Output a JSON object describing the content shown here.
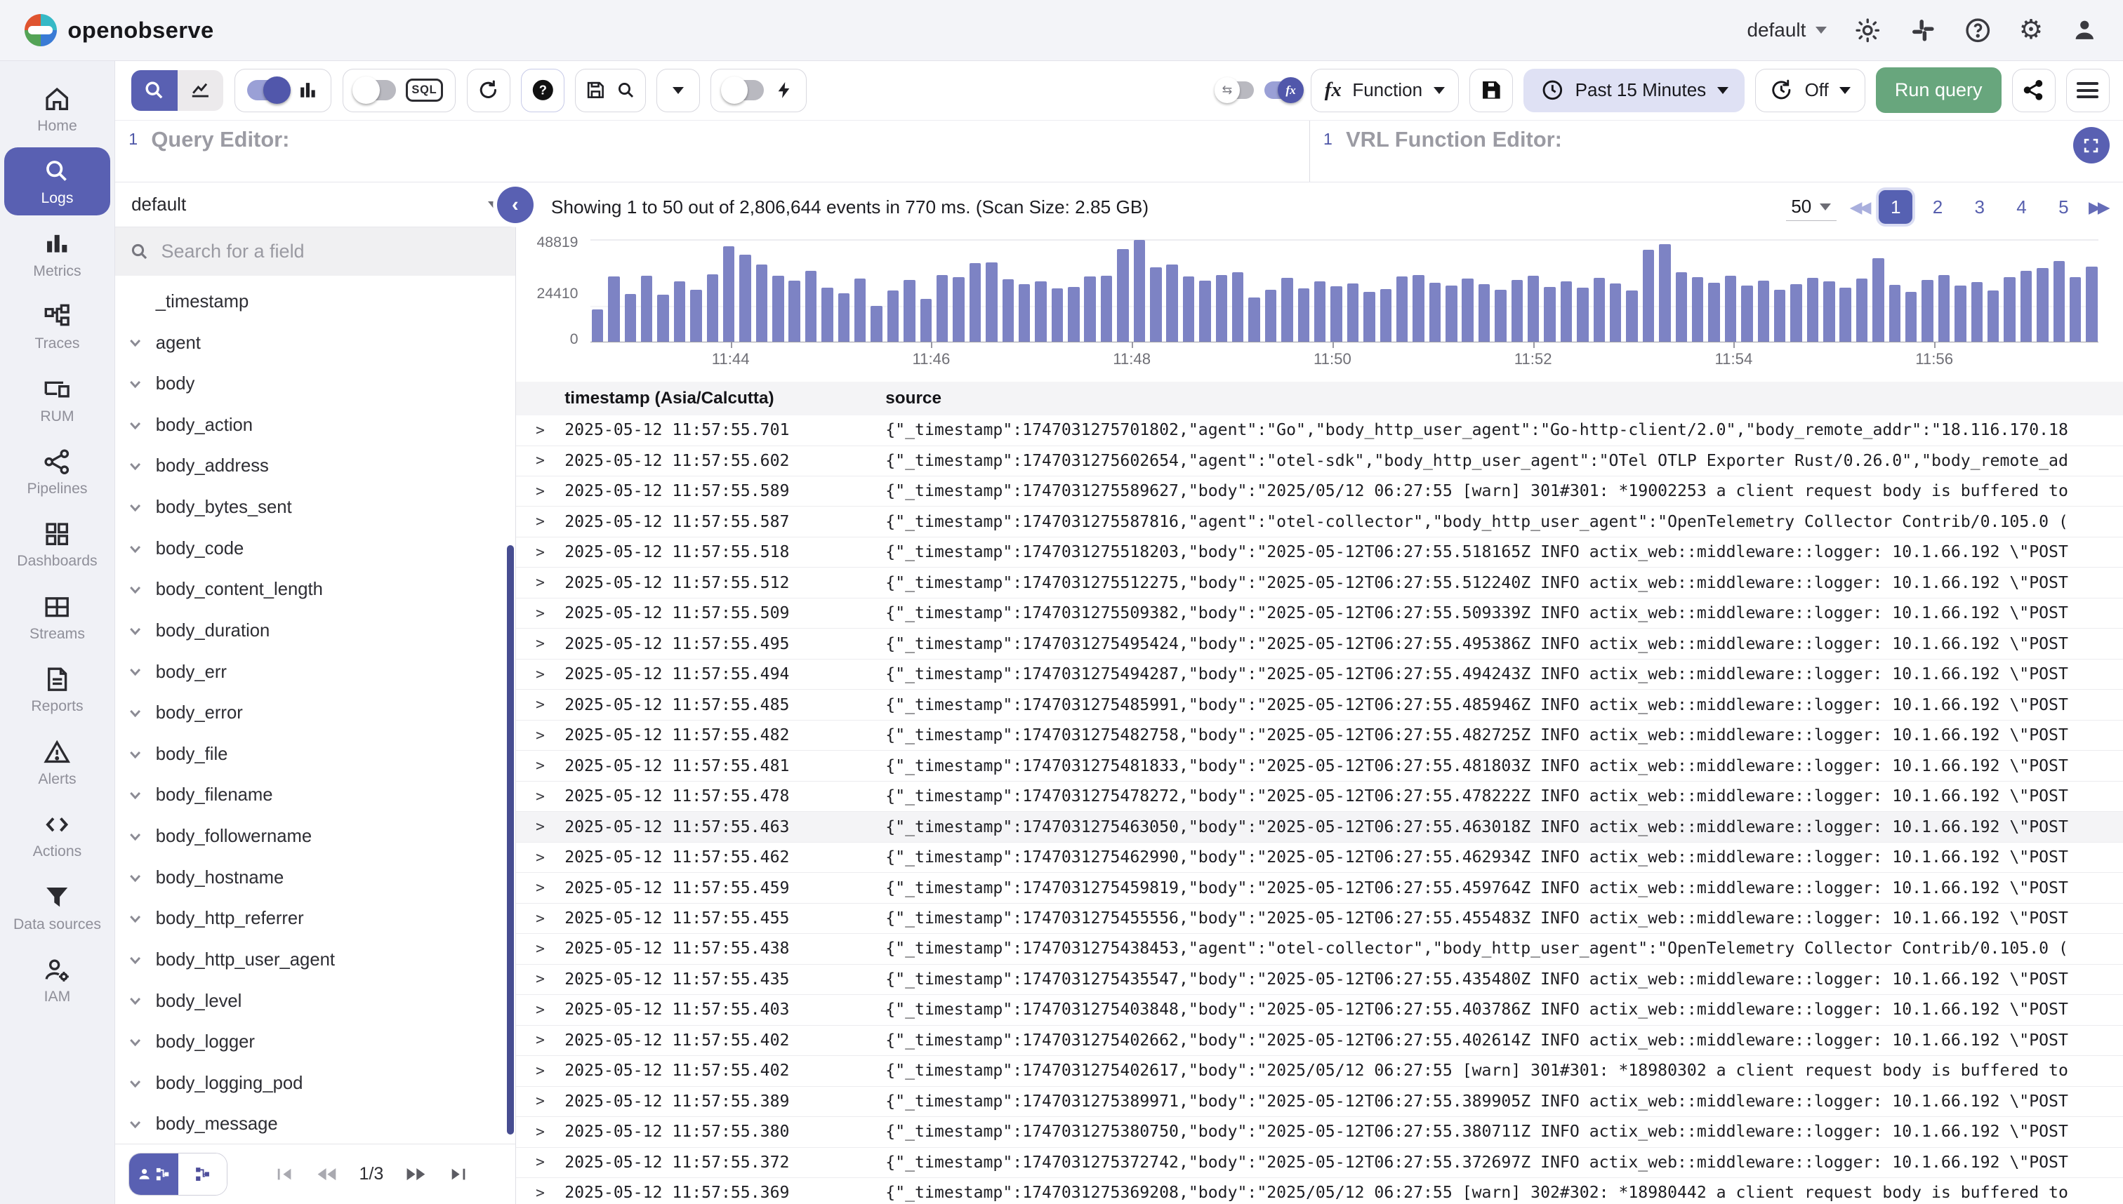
{
  "header": {
    "brand": "openobserve",
    "org": "default"
  },
  "toolbar": {
    "sql_label": "SQL",
    "function_label": "Function",
    "time_range_label": "Past 15 Minutes",
    "auto_refresh_label": "Off",
    "run_query_label": "Run query"
  },
  "editors": {
    "query_line": "1",
    "query_placeholder": "Query Editor:",
    "vrl_line": "1",
    "vrl_placeholder": "VRL Function Editor:"
  },
  "sidebar": {
    "items": [
      {
        "label": "Home"
      },
      {
        "label": "Logs"
      },
      {
        "label": "Metrics"
      },
      {
        "label": "Traces"
      },
      {
        "label": "RUM"
      },
      {
        "label": "Pipelines"
      },
      {
        "label": "Dashboards"
      },
      {
        "label": "Streams"
      },
      {
        "label": "Reports"
      },
      {
        "label": "Alerts"
      },
      {
        "label": "Actions"
      },
      {
        "label": "Data sources"
      },
      {
        "label": "IAM"
      }
    ]
  },
  "fields": {
    "stream": "default",
    "search_placeholder": "Search for a field",
    "pagination": "1/3",
    "items": [
      {
        "label": "_timestamp",
        "expandable": false
      },
      {
        "label": "agent",
        "expandable": true
      },
      {
        "label": "body",
        "expandable": true
      },
      {
        "label": "body_action",
        "expandable": true
      },
      {
        "label": "body_address",
        "expandable": true
      },
      {
        "label": "body_bytes_sent",
        "expandable": true
      },
      {
        "label": "body_code",
        "expandable": true
      },
      {
        "label": "body_content_length",
        "expandable": true
      },
      {
        "label": "body_duration",
        "expandable": true
      },
      {
        "label": "body_err",
        "expandable": true
      },
      {
        "label": "body_error",
        "expandable": true
      },
      {
        "label": "body_file",
        "expandable": true
      },
      {
        "label": "body_filename",
        "expandable": true
      },
      {
        "label": "body_followername",
        "expandable": true
      },
      {
        "label": "body_hostname",
        "expandable": true
      },
      {
        "label": "body_http_referrer",
        "expandable": true
      },
      {
        "label": "body_http_user_agent",
        "expandable": true
      },
      {
        "label": "body_level",
        "expandable": true
      },
      {
        "label": "body_logger",
        "expandable": true
      },
      {
        "label": "body_logging_pod",
        "expandable": true
      },
      {
        "label": "body_message",
        "expandable": true
      }
    ]
  },
  "results": {
    "summary": "Showing 1 to 50 out of 2,806,644 events in 770 ms. (Scan Size: 2.85 GB)",
    "page_size": "50",
    "pages": [
      "1",
      "2",
      "3",
      "4",
      "5"
    ]
  },
  "chart_data": {
    "type": "bar",
    "title": "",
    "xlabel": "",
    "ylabel": "",
    "ylim": [
      0,
      48819
    ],
    "y_tick_labels": [
      "48819",
      "24410",
      "0"
    ],
    "x_ticks": [
      {
        "label": "11:44",
        "pct": 9.3
      },
      {
        "label": "11:46",
        "pct": 22.6
      },
      {
        "label": "11:48",
        "pct": 35.9
      },
      {
        "label": "11:50",
        "pct": 49.2
      },
      {
        "label": "11:52",
        "pct": 62.5
      },
      {
        "label": "11:54",
        "pct": 75.8
      },
      {
        "label": "11:56",
        "pct": 89.1
      }
    ],
    "values": [
      15500,
      31000,
      22800,
      31500,
      22500,
      28800,
      24700,
      32300,
      45500,
      41500,
      37000,
      31500,
      29300,
      33800,
      25800,
      23200,
      30200,
      17200,
      24600,
      29400,
      20400,
      31800,
      30700,
      37400,
      37800,
      29700,
      27600,
      28700,
      25400,
      26000,
      31000,
      31600,
      44300,
      48700,
      35500,
      36700,
      31100,
      29000,
      31700,
      33100,
      21000,
      24700,
      30500,
      25300,
      28900,
      26400,
      27800,
      23900,
      25100,
      31200,
      31900,
      28300,
      26700,
      30100,
      27400,
      24800,
      29600,
      31400,
      26200,
      28800,
      25700,
      30400,
      27900,
      24300,
      44000,
      46500,
      33200,
      30800,
      28100,
      31600,
      26900,
      29300,
      24800,
      27400,
      30600,
      28800,
      25900,
      30200,
      39800,
      27100,
      23800,
      29500,
      31700,
      26900,
      28400,
      24600,
      30800,
      33700,
      35200,
      38500,
      30900,
      35800
    ],
    "bar_color": "#7d83c4",
    "legend": []
  },
  "table": {
    "columns": [
      "timestamp (Asia/Calcutta)",
      "source"
    ],
    "rows": [
      {
        "ts": "2025-05-12 11:57:55.701",
        "src": "{\"_timestamp\":1747031275701802,\"agent\":\"Go\",\"body_http_user_agent\":\"Go-http-client/2.0\",\"body_remote_addr\":\"18.116.170.18",
        "highlight": false
      },
      {
        "ts": "2025-05-12 11:57:55.602",
        "src": "{\"_timestamp\":1747031275602654,\"agent\":\"otel-sdk\",\"body_http_user_agent\":\"OTel OTLP Exporter Rust/0.26.0\",\"body_remote_ad",
        "highlight": false
      },
      {
        "ts": "2025-05-12 11:57:55.589",
        "src": "{\"_timestamp\":1747031275589627,\"body\":\"2025/05/12 06:27:55 [warn] 301#301: *19002253 a client request body is buffered to",
        "highlight": false
      },
      {
        "ts": "2025-05-12 11:57:55.587",
        "src": "{\"_timestamp\":1747031275587816,\"agent\":\"otel-collector\",\"body_http_user_agent\":\"OpenTelemetry Collector Contrib/0.105.0 (",
        "highlight": false
      },
      {
        "ts": "2025-05-12 11:57:55.518",
        "src": "{\"_timestamp\":1747031275518203,\"body\":\"2025-05-12T06:27:55.518165Z INFO actix_web::middleware::logger: 10.1.66.192 \\\"POST",
        "highlight": false
      },
      {
        "ts": "2025-05-12 11:57:55.512",
        "src": "{\"_timestamp\":1747031275512275,\"body\":\"2025-05-12T06:27:55.512240Z INFO actix_web::middleware::logger: 10.1.66.192 \\\"POST",
        "highlight": false
      },
      {
        "ts": "2025-05-12 11:57:55.509",
        "src": "{\"_timestamp\":1747031275509382,\"body\":\"2025-05-12T06:27:55.509339Z INFO actix_web::middleware::logger: 10.1.66.192 \\\"POST",
        "highlight": false
      },
      {
        "ts": "2025-05-12 11:57:55.495",
        "src": "{\"_timestamp\":1747031275495424,\"body\":\"2025-05-12T06:27:55.495386Z INFO actix_web::middleware::logger: 10.1.66.192 \\\"POST",
        "highlight": false
      },
      {
        "ts": "2025-05-12 11:57:55.494",
        "src": "{\"_timestamp\":1747031275494287,\"body\":\"2025-05-12T06:27:55.494243Z INFO actix_web::middleware::logger: 10.1.66.192 \\\"POST",
        "highlight": false
      },
      {
        "ts": "2025-05-12 11:57:55.485",
        "src": "{\"_timestamp\":1747031275485991,\"body\":\"2025-05-12T06:27:55.485946Z INFO actix_web::middleware::logger: 10.1.66.192 \\\"POST",
        "highlight": false
      },
      {
        "ts": "2025-05-12 11:57:55.482",
        "src": "{\"_timestamp\":1747031275482758,\"body\":\"2025-05-12T06:27:55.482725Z INFO actix_web::middleware::logger: 10.1.66.192 \\\"POST",
        "highlight": false
      },
      {
        "ts": "2025-05-12 11:57:55.481",
        "src": "{\"_timestamp\":1747031275481833,\"body\":\"2025-05-12T06:27:55.481803Z INFO actix_web::middleware::logger: 10.1.66.192 \\\"POST",
        "highlight": false
      },
      {
        "ts": "2025-05-12 11:57:55.478",
        "src": "{\"_timestamp\":1747031275478272,\"body\":\"2025-05-12T06:27:55.478222Z INFO actix_web::middleware::logger: 10.1.66.192 \\\"POST",
        "highlight": false
      },
      {
        "ts": "2025-05-12 11:57:55.463",
        "src": "{\"_timestamp\":1747031275463050,\"body\":\"2025-05-12T06:27:55.463018Z INFO actix_web::middleware::logger: 10.1.66.192 \\\"POST",
        "highlight": true
      },
      {
        "ts": "2025-05-12 11:57:55.462",
        "src": "{\"_timestamp\":1747031275462990,\"body\":\"2025-05-12T06:27:55.462934Z INFO actix_web::middleware::logger: 10.1.66.192 \\\"POST",
        "highlight": false
      },
      {
        "ts": "2025-05-12 11:57:55.459",
        "src": "{\"_timestamp\":1747031275459819,\"body\":\"2025-05-12T06:27:55.459764Z INFO actix_web::middleware::logger: 10.1.66.192 \\\"POST",
        "highlight": false
      },
      {
        "ts": "2025-05-12 11:57:55.455",
        "src": "{\"_timestamp\":1747031275455556,\"body\":\"2025-05-12T06:27:55.455483Z INFO actix_web::middleware::logger: 10.1.66.192 \\\"POST",
        "highlight": false
      },
      {
        "ts": "2025-05-12 11:57:55.438",
        "src": "{\"_timestamp\":1747031275438453,\"agent\":\"otel-collector\",\"body_http_user_agent\":\"OpenTelemetry Collector Contrib/0.105.0 (",
        "highlight": false
      },
      {
        "ts": "2025-05-12 11:57:55.435",
        "src": "{\"_timestamp\":1747031275435547,\"body\":\"2025-05-12T06:27:55.435480Z INFO actix_web::middleware::logger: 10.1.66.192 \\\"POST",
        "highlight": false
      },
      {
        "ts": "2025-05-12 11:57:55.403",
        "src": "{\"_timestamp\":1747031275403848,\"body\":\"2025-05-12T06:27:55.403786Z INFO actix_web::middleware::logger: 10.1.66.192 \\\"POST",
        "highlight": false
      },
      {
        "ts": "2025-05-12 11:57:55.402",
        "src": "{\"_timestamp\":1747031275402662,\"body\":\"2025-05-12T06:27:55.402614Z INFO actix_web::middleware::logger: 10.1.66.192 \\\"POST",
        "highlight": false
      },
      {
        "ts": "2025-05-12 11:57:55.402",
        "src": "{\"_timestamp\":1747031275402617,\"body\":\"2025/05/12 06:27:55 [warn] 301#301: *18980302 a client request body is buffered to",
        "highlight": false
      },
      {
        "ts": "2025-05-12 11:57:55.389",
        "src": "{\"_timestamp\":1747031275389971,\"body\":\"2025-05-12T06:27:55.389905Z INFO actix_web::middleware::logger: 10.1.66.192 \\\"POST",
        "highlight": false
      },
      {
        "ts": "2025-05-12 11:57:55.380",
        "src": "{\"_timestamp\":1747031275380750,\"body\":\"2025-05-12T06:27:55.380711Z INFO actix_web::middleware::logger: 10.1.66.192 \\\"POST",
        "highlight": false
      },
      {
        "ts": "2025-05-12 11:57:55.372",
        "src": "{\"_timestamp\":1747031275372742,\"body\":\"2025-05-12T06:27:55.372697Z INFO actix_web::middleware::logger: 10.1.66.192 \\\"POST",
        "highlight": false
      },
      {
        "ts": "2025-05-12 11:57:55.369",
        "src": "{\"_timestamp\":1747031275369208,\"body\":\"2025/05/12 06:27:55 [warn] 302#302: *18980442 a client request body is buffered to",
        "highlight": false
      }
    ]
  },
  "colors": {
    "accent": "#5960b2",
    "bar": "#7d83c4",
    "run_button": "#68a67d",
    "time_range_bg": "#dfe1f4"
  }
}
